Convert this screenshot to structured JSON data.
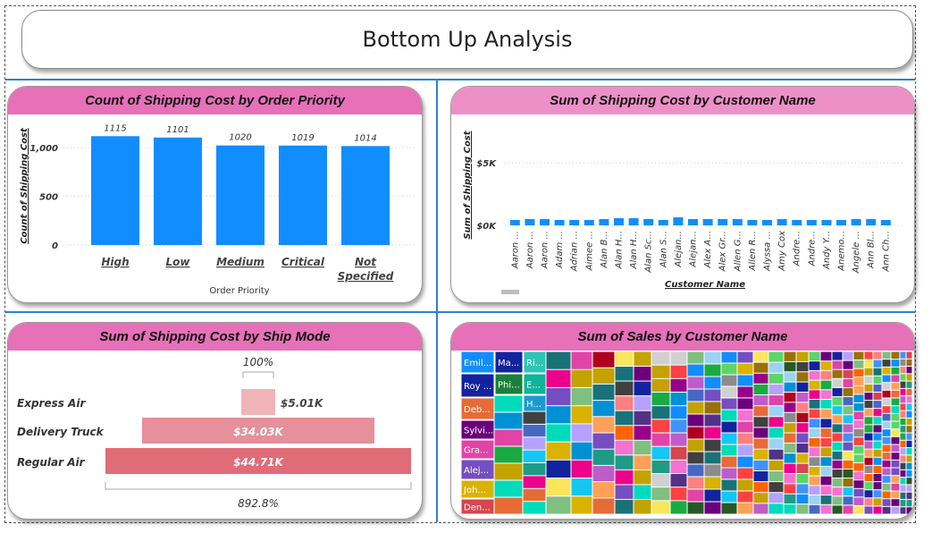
{
  "page": {
    "title": "Bottom Up Analysis"
  },
  "priority_chart": {
    "title": "Count of Shipping Cost by Order Priority",
    "xlabel": "Order Priority",
    "ylabel": "Count of Shipping Cost",
    "yticks": [
      "0",
      "500",
      "1,000"
    ],
    "categories": [
      "High",
      "Low",
      "Medium",
      "Critical",
      "Not Specified"
    ],
    "values": [
      1115,
      1101,
      1020,
      1019,
      1014
    ],
    "value_labels": [
      "1115",
      "1101",
      "1020",
      "1019",
      "1014"
    ],
    "color": "#118dff"
  },
  "customer_chart": {
    "title": "Sum of Shipping Cost by Customer Name",
    "xlabel": "Customer Name",
    "ylabel": "Sum of Shipping Cost",
    "yticks": [
      "$0K",
      "$5K"
    ],
    "color": "#118dff",
    "categories": [
      "Aaron ...",
      "Aaron ...",
      "Aaron ...",
      "Adam ...",
      "Adrian ...",
      "Aimee ...",
      "Alan B...",
      "Alan H...",
      "Alan H...",
      "Alan Sc...",
      "Alan S...",
      "Alejan...",
      "Alejan...",
      "Alex A...",
      "Alex Gr...",
      "Allen G...",
      "Allen R...",
      "Alyssa ...",
      "Amy Cox",
      "Andre...",
      "Andre...",
      "Andy Y...",
      "Anemo...",
      "Angele ...",
      "Ann Bl...",
      "Ann Ch..."
    ]
  },
  "shipmode_chart": {
    "title": "Sum of Shipping Cost by Ship Mode",
    "categories": [
      "Express Air",
      "Delivery Truck",
      "Regular Air"
    ],
    "value_labels": [
      "$5.01K",
      "$34.03K",
      "$44.71K"
    ],
    "top_label": "100%",
    "bottom_label": "892.8%",
    "colors": [
      "#f0b4b8",
      "#e5909a",
      "#e06c78"
    ]
  },
  "sales_treemap": {
    "title": "Sum of Sales by Customer Name",
    "labels": [
      "Emil...",
      "Ma...",
      "Ri...",
      "Roy ...",
      "Phi...",
      "E...",
      "H...",
      "Deb...",
      "Sylvi...",
      "Gra...",
      "Alej...",
      "Joh...",
      "Den..."
    ]
  }
}
